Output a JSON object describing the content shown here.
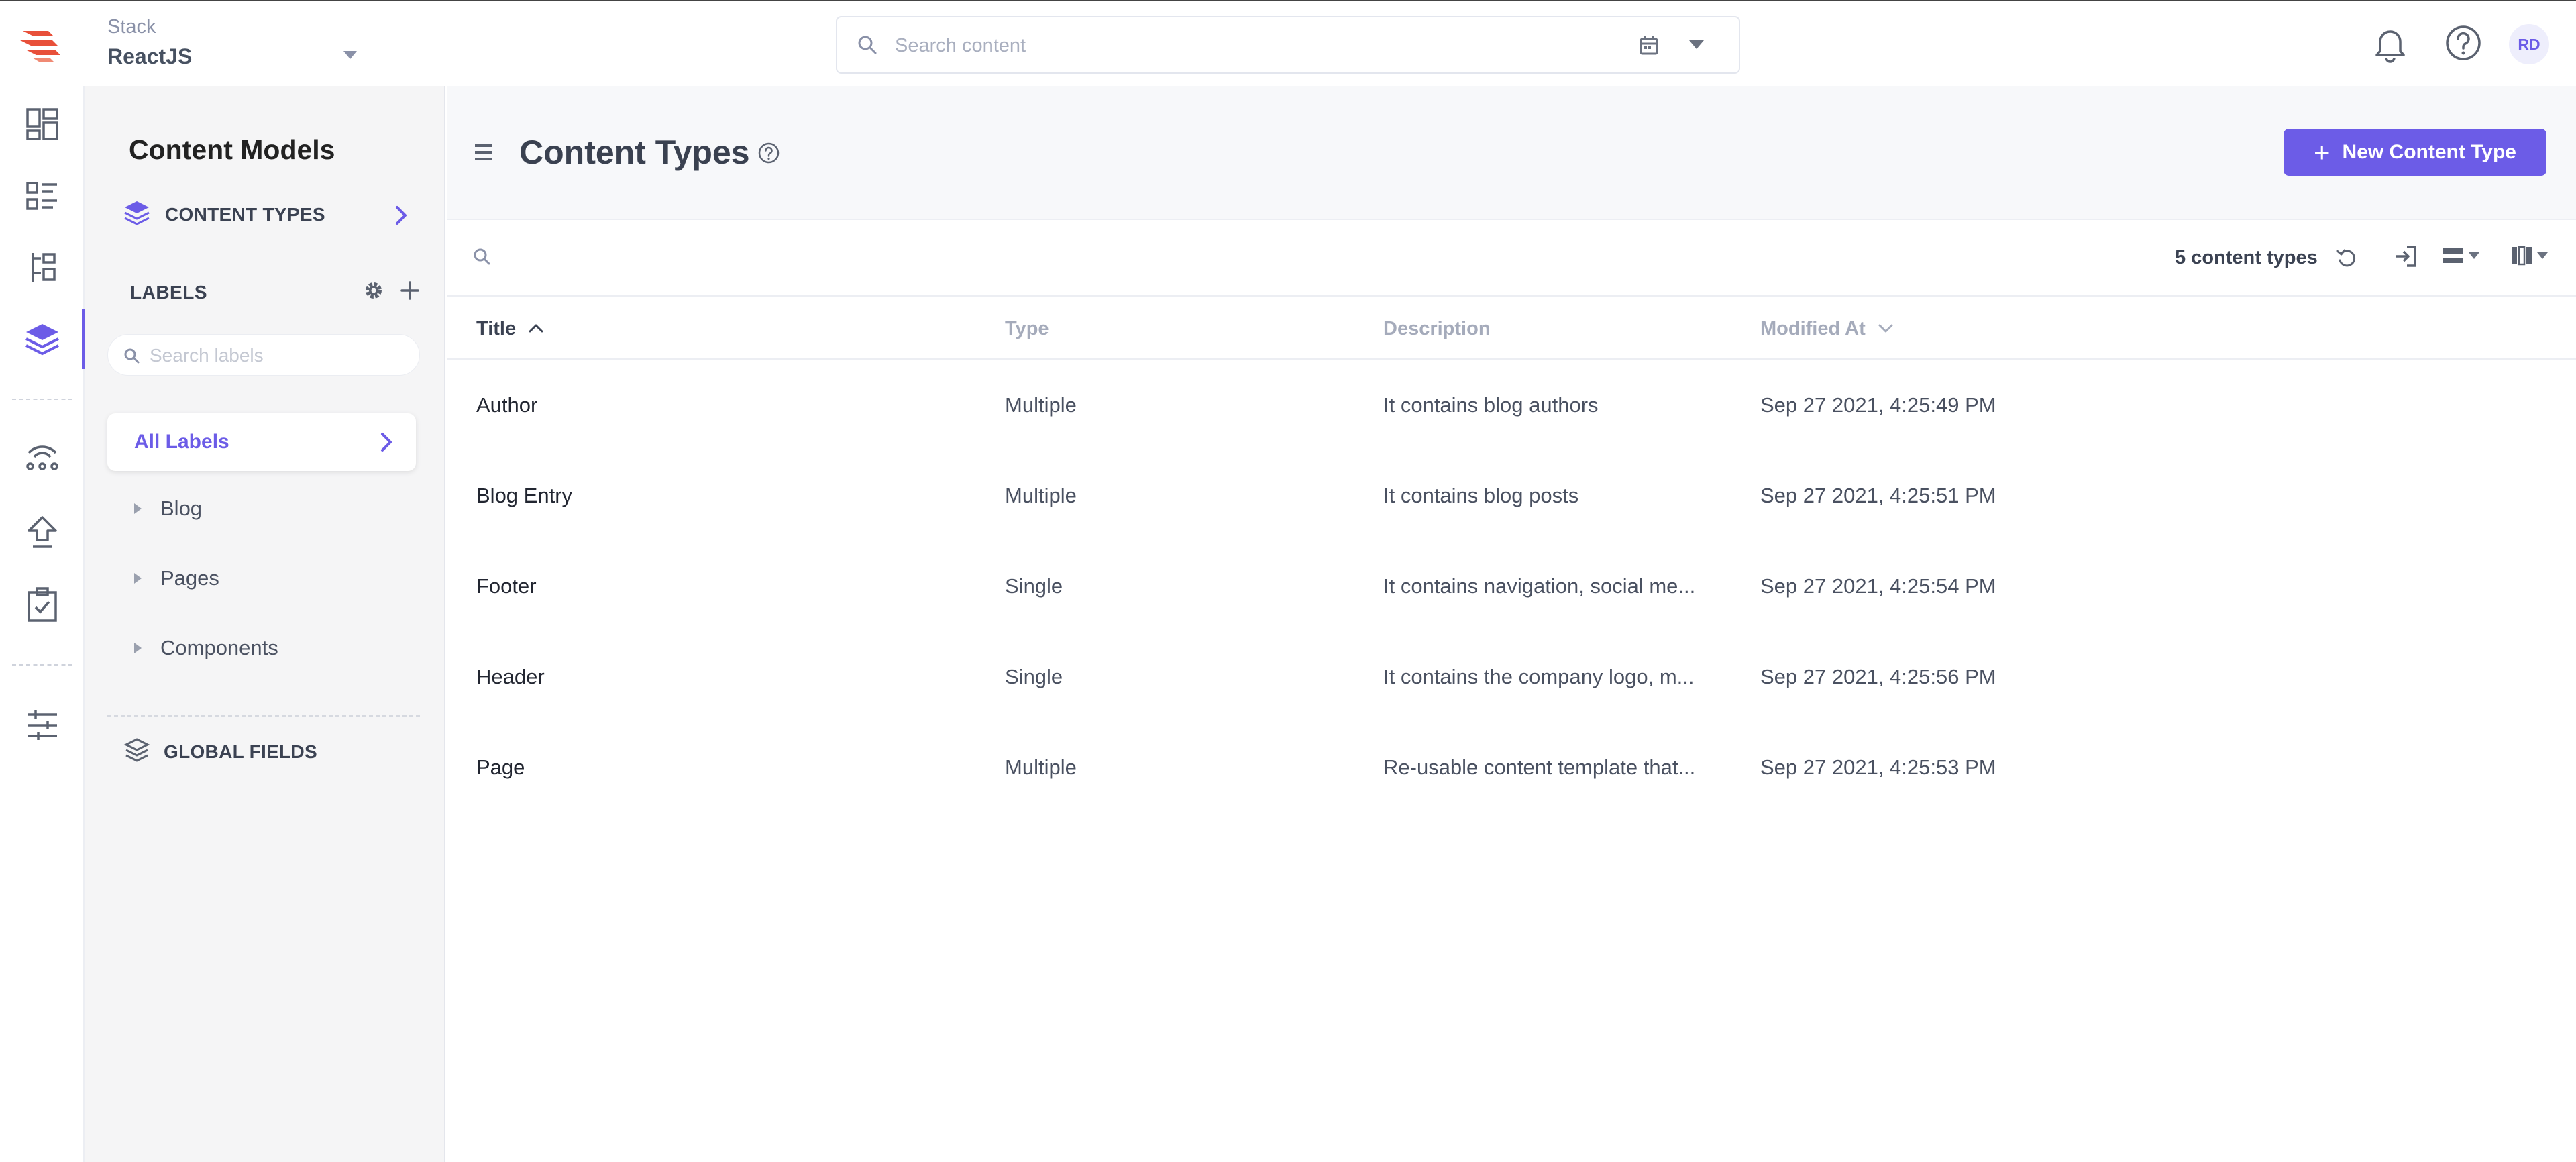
{
  "header": {
    "stack_label": "Stack",
    "stack_name": "ReactJS",
    "search_placeholder": "Search content",
    "avatar_initials": "RD"
  },
  "sidebar": {
    "title": "Content Models",
    "content_types_label": "CONTENT TYPES",
    "labels_heading": "LABELS",
    "search_labels_placeholder": "Search labels",
    "all_labels": "All Labels",
    "labels": [
      {
        "label": "Blog"
      },
      {
        "label": "Pages"
      },
      {
        "label": "Components"
      }
    ],
    "global_fields_label": "GLOBAL FIELDS"
  },
  "main": {
    "title": "Content Types",
    "new_button_label": "New Content Type",
    "count_text": "5 content types",
    "columns": {
      "title": "Title",
      "type": "Type",
      "description": "Description",
      "modified": "Modified At"
    },
    "rows": [
      {
        "title": "Author",
        "type": "Multiple",
        "description": "It contains blog authors",
        "modified": "Sep 27 2021, 4:25:49 PM"
      },
      {
        "title": "Blog Entry",
        "type": "Multiple",
        "description": "It contains blog posts",
        "modified": "Sep 27 2021, 4:25:51 PM"
      },
      {
        "title": "Footer",
        "type": "Single",
        "description": "It contains navigation, social me...",
        "modified": "Sep 27 2021, 4:25:54 PM"
      },
      {
        "title": "Header",
        "type": "Single",
        "description": "It contains the company logo, m...",
        "modified": "Sep 27 2021, 4:25:56 PM"
      },
      {
        "title": "Page",
        "type": "Multiple",
        "description": "Re-usable content template that...",
        "modified": "Sep 27 2021, 4:25:53 PM"
      }
    ]
  },
  "colors": {
    "accent": "#6c5ce7",
    "logo": "#e8503a",
    "sidebar_bg": "#f5f5f6",
    "header_bg": "#f7f8fa"
  },
  "icons": {
    "rail": [
      "dashboard-icon",
      "entries-icon",
      "assets-icon",
      "content-models-icon",
      "webhooks-icon",
      "publish-queue-icon",
      "tasks-icon",
      "settings-icon"
    ]
  }
}
